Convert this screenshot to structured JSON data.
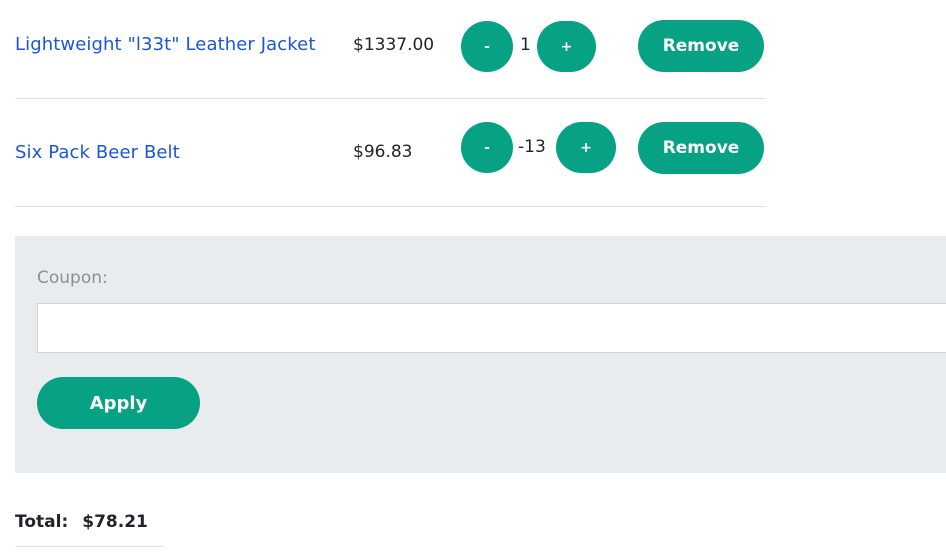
{
  "cart": {
    "items": [
      {
        "name": "Lightweight \"l33t\" Leather Jacket",
        "price": "$1337.00",
        "quantity": "1",
        "decrement_label": "-",
        "increment_label": "+",
        "remove_label": "Remove"
      },
      {
        "name": "Six Pack Beer Belt",
        "price": "$96.83",
        "quantity": "-13",
        "decrement_label": "-",
        "increment_label": "+",
        "remove_label": "Remove"
      }
    ]
  },
  "coupon": {
    "label": "Coupon:",
    "value": "",
    "apply_label": "Apply"
  },
  "summary": {
    "total_label": "Total:",
    "total_value": "$78.21"
  },
  "colors": {
    "accent": "#06a283",
    "link": "#1a56db",
    "panel": "#e9ecef"
  }
}
